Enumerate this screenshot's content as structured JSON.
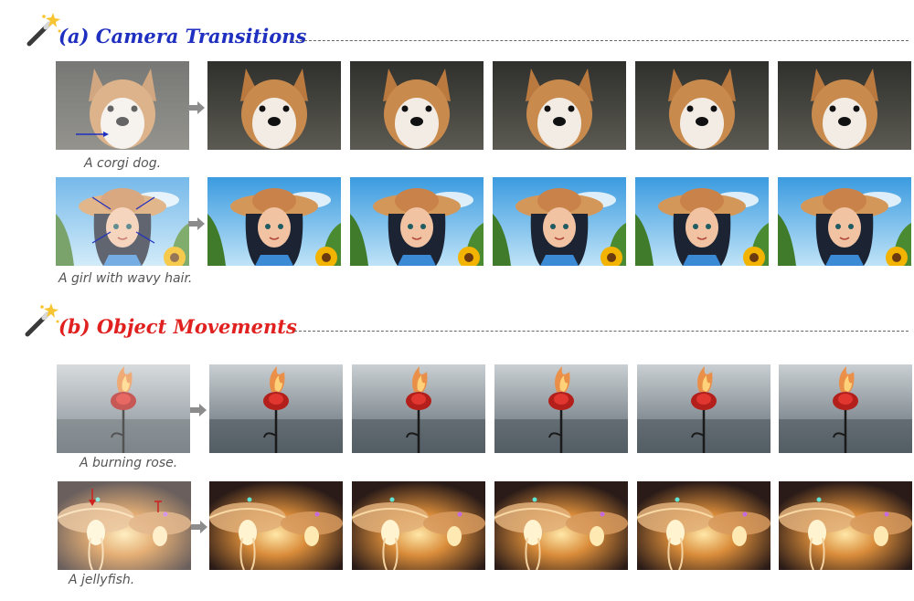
{
  "sections": [
    {
      "title": "(a) Camera Transitions",
      "color": "#1f2fbf",
      "wand_icon": "magic-wand-icon"
    },
    {
      "title": "(b) Object Movements",
      "color": "#e0211f",
      "wand_icon": "magic-wand-icon"
    }
  ],
  "rows": [
    {
      "caption": "A corgi dog.",
      "subject": "corgi"
    },
    {
      "caption": "A girl with wavy hair.",
      "subject": "girl"
    },
    {
      "caption": "A burning rose.",
      "subject": "rose"
    },
    {
      "caption": "A jellyfish.",
      "subject": "jellyfish"
    }
  ],
  "arrow_icon": "right-arrow-icon"
}
